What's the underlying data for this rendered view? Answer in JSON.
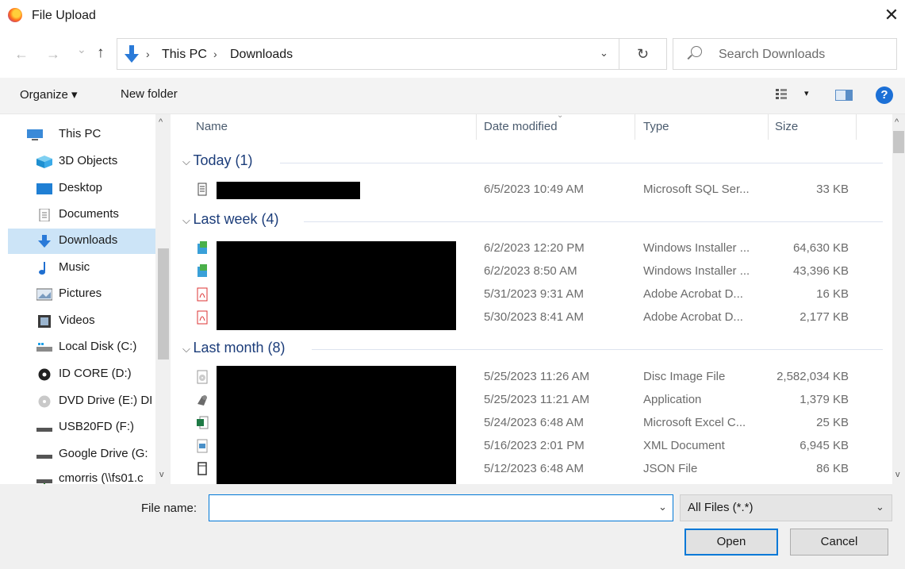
{
  "window": {
    "title": "File Upload",
    "close": "✕"
  },
  "nav": {
    "back": "←",
    "forward": "→",
    "recent": "⌄",
    "up": "↑",
    "breadcrumb": [
      "This PC",
      "Downloads"
    ],
    "separator": "›",
    "dropdown": "⌄",
    "refresh": "↻",
    "search_placeholder": "Search Downloads"
  },
  "toolbar": {
    "organize": "Organize ▾",
    "new_folder": "New folder",
    "view_drop": "▾",
    "help": "?"
  },
  "sidebar": {
    "items": [
      {
        "label": "This PC",
        "icon": "pc-icon"
      },
      {
        "label": "3D Objects",
        "icon": "cube-icon"
      },
      {
        "label": "Desktop",
        "icon": "desktop-icon"
      },
      {
        "label": "Documents",
        "icon": "document-icon"
      },
      {
        "label": "Downloads",
        "icon": "download-icon",
        "selected": true
      },
      {
        "label": "Music",
        "icon": "music-icon"
      },
      {
        "label": "Pictures",
        "icon": "pictures-icon"
      },
      {
        "label": "Videos",
        "icon": "video-icon"
      },
      {
        "label": "Local Disk (C:)",
        "icon": "drive-icon"
      },
      {
        "label": "ID CORE (D:)",
        "icon": "disc-icon"
      },
      {
        "label": "DVD Drive (E:) DI",
        "icon": "dvd-icon"
      },
      {
        "label": "USB20FD (F:)",
        "icon": "usb-drive-icon"
      },
      {
        "label": "Google Drive (G:",
        "icon": "drive-icon"
      },
      {
        "label": "cmorris (\\\\fs01.c",
        "icon": "network-drive-icon"
      }
    ],
    "scroll_up": "^",
    "scroll_down": "v"
  },
  "columns": {
    "name": "Name",
    "date": "Date modified",
    "type": "Type",
    "size": "Size"
  },
  "groups": [
    {
      "label": "Today (1)",
      "rows": [
        {
          "icon": "sql-file-icon",
          "date": "6/5/2023 10:49 AM",
          "type": "Microsoft SQL Ser...",
          "size": "33 KB"
        }
      ]
    },
    {
      "label": "Last week (4)",
      "rows": [
        {
          "icon": "installer-icon",
          "date": "6/2/2023 12:20 PM",
          "type": "Windows Installer ...",
          "size": "64,630 KB"
        },
        {
          "icon": "installer-icon",
          "date": "6/2/2023 8:50 AM",
          "type": "Windows Installer ...",
          "size": "43,396 KB"
        },
        {
          "icon": "pdf-icon",
          "date": "5/31/2023 9:31 AM",
          "type": "Adobe Acrobat D...",
          "size": "16 KB"
        },
        {
          "icon": "pdf-icon",
          "date": "5/30/2023 8:41 AM",
          "type": "Adobe Acrobat D...",
          "size": "2,177 KB"
        }
      ]
    },
    {
      "label": "Last month (8)",
      "rows": [
        {
          "icon": "disc-image-icon",
          "date": "5/25/2023 11:26 AM",
          "type": "Disc Image File",
          "size": "2,582,034 KB"
        },
        {
          "icon": "application-icon",
          "date": "5/25/2023 11:21 AM",
          "type": "Application",
          "size": "1,379 KB"
        },
        {
          "icon": "excel-icon",
          "date": "5/24/2023 6:48 AM",
          "type": "Microsoft Excel C...",
          "size": "25 KB"
        },
        {
          "icon": "xml-icon",
          "date": "5/16/2023 2:01 PM",
          "type": "XML Document",
          "size": "6,945 KB"
        },
        {
          "icon": "json-icon",
          "date": "5/12/2023 6:48 AM",
          "type": "JSON File",
          "size": "86 KB"
        }
      ]
    }
  ],
  "footer": {
    "file_name_label": "File name:",
    "file_name_value": "",
    "filter": "All Files (*.*)",
    "dropdown": "⌄",
    "open": "Open",
    "cancel": "Cancel"
  }
}
